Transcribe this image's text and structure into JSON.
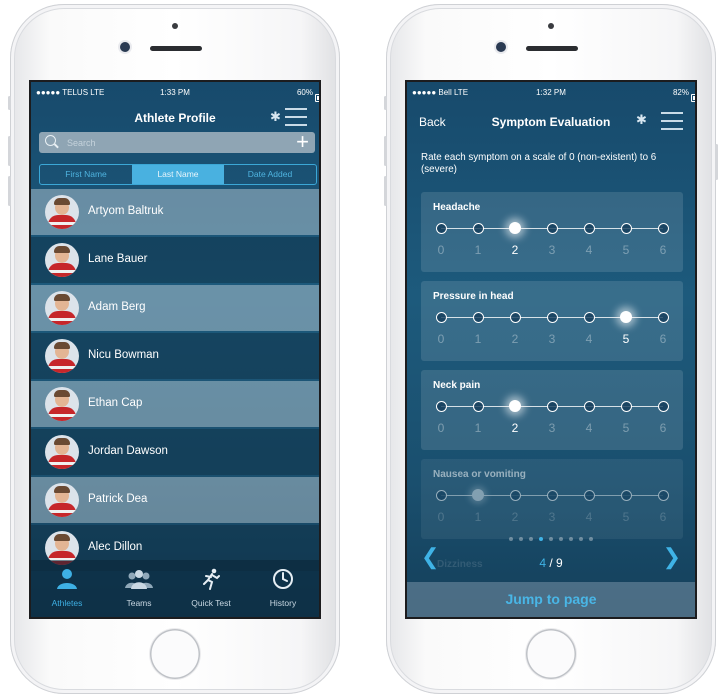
{
  "left": {
    "status": {
      "carrier": "●●●●● TELUS  LTE",
      "time": "1:33 PM",
      "battery": "60%",
      "battery_level": 0.6
    },
    "title": "Athlete Profile",
    "search_placeholder": "Search",
    "segments": [
      "First Name",
      "Last Name",
      "Date Added"
    ],
    "active_segment": 1,
    "athletes": [
      "Artyom Baltruk",
      "Lane Bauer",
      "Adam Berg",
      "Nicu Bowman",
      "Ethan Cap",
      "Jordan Dawson",
      "Patrick Dea",
      "Alec Dillon"
    ],
    "tabs": [
      {
        "label": "Athletes",
        "icon": "person-icon"
      },
      {
        "label": "Teams",
        "icon": "group-icon"
      },
      {
        "label": "Quick Test",
        "icon": "runner-icon"
      },
      {
        "label": "History",
        "icon": "clock-icon"
      }
    ],
    "active_tab": 0
  },
  "right": {
    "status": {
      "carrier": "●●●●● Bell  LTE",
      "time": "1:32 PM",
      "battery": "82%",
      "battery_level": 0.82
    },
    "back_label": "Back",
    "title": "Symptom Evaluation",
    "instruction": "Rate each symptom on a scale of 0 (non-existent) to 6 (severe)",
    "scale": [
      "0",
      "1",
      "2",
      "3",
      "4",
      "5",
      "6"
    ],
    "symptoms": [
      {
        "name": "Headache",
        "value": 2
      },
      {
        "name": "Pressure in head",
        "value": 5
      },
      {
        "name": "Neck pain",
        "value": 2
      },
      {
        "name": "Nausea or vomiting",
        "value": 1
      }
    ],
    "ghost_label": "Dizziness",
    "page_current": "4",
    "page_total": "/ 9",
    "page_index": 4,
    "page_count": 9,
    "jump_label": "Jump to page",
    "colors": {
      "accent": "#3fb3e6"
    }
  }
}
